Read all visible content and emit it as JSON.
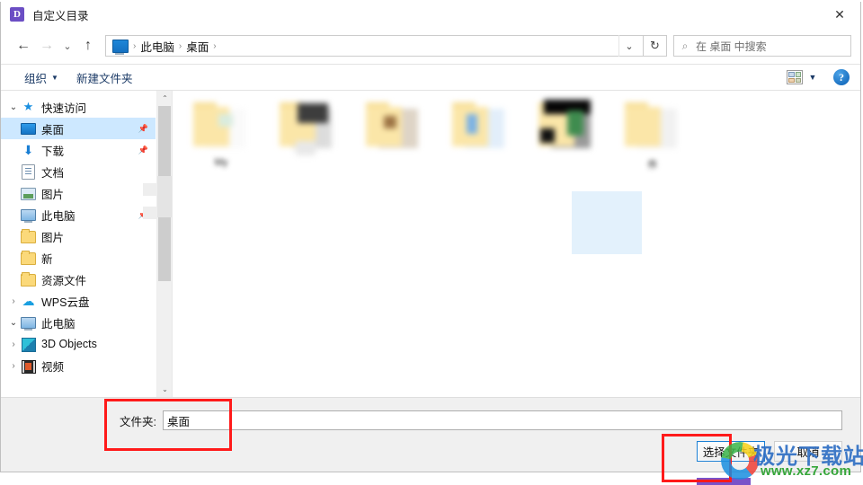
{
  "window": {
    "title": "自定义目录",
    "app_icon": "D",
    "app_icon_color": "#6b4ec4",
    "close_label": "✕"
  },
  "navbar": {
    "back_icon": "←",
    "forward_icon": "→",
    "recent_icon": "⌄",
    "up_icon": "↑",
    "breadcrumb": {
      "icon_name": "this-pc-icon",
      "items": [
        "此电脑",
        "桌面"
      ],
      "separator": "›",
      "dropdown_icon": "⌄"
    },
    "refresh_icon": "↻",
    "search": {
      "icon": "⌕",
      "placeholder": "在 桌面 中搜索",
      "value": ""
    }
  },
  "toolbar": {
    "organize_label": "组织",
    "organize_caret": "▼",
    "new_folder_label": "新建文件夹",
    "view_caret": "▼",
    "help_label": "?"
  },
  "sidebar": {
    "items": [
      {
        "label": "快速访问",
        "indent": 0,
        "twisty": "⌄",
        "icon": "quick-access-star-icon",
        "pinned": false,
        "selected": false
      },
      {
        "label": "桌面",
        "indent": 1,
        "twisty": "",
        "icon": "desktop-icon",
        "pinned": true,
        "selected": true
      },
      {
        "label": "下载",
        "indent": 1,
        "twisty": "",
        "icon": "downloads-icon",
        "pinned": true,
        "selected": false
      },
      {
        "label": "文档",
        "indent": 1,
        "twisty": "",
        "icon": "documents-icon",
        "pinned": false,
        "selected": false
      },
      {
        "label": "图片",
        "indent": 1,
        "twisty": "",
        "icon": "pictures-icon",
        "pinned": false,
        "selected": false
      },
      {
        "label": "此电脑",
        "indent": 1,
        "twisty": "",
        "icon": "this-pc-icon",
        "pinned": true,
        "selected": false
      },
      {
        "label": "图片",
        "indent": 1,
        "twisty": "",
        "icon": "folder-icon",
        "pinned": false,
        "selected": false
      },
      {
        "label": "新",
        "indent": 1,
        "twisty": "",
        "icon": "folder-icon",
        "pinned": false,
        "selected": false
      },
      {
        "label": "资源文件",
        "indent": 1,
        "twisty": "",
        "icon": "folder-icon",
        "pinned": false,
        "selected": false
      },
      {
        "label": "WPS云盘",
        "indent": 0,
        "twisty": "›",
        "icon": "cloud-icon",
        "pinned": false,
        "selected": false
      },
      {
        "label": "此电脑",
        "indent": 0,
        "twisty": "⌄",
        "icon": "this-pc-icon",
        "pinned": false,
        "selected": false
      },
      {
        "label": "3D Objects",
        "indent": 1,
        "twisty": "›",
        "icon": "3d-objects-icon",
        "pinned": false,
        "selected": false
      },
      {
        "label": "视频",
        "indent": 1,
        "twisty": "›",
        "icon": "videos-icon",
        "pinned": false,
        "selected": false
      }
    ],
    "scrollbar": {
      "up_arrow": "⌃",
      "down_arrow": "⌄"
    }
  },
  "files": {
    "items": [
      {
        "label": "My",
        "blurred": true,
        "selected": false
      },
      {
        "label": "",
        "blurred": true,
        "selected": false
      },
      {
        "label": "",
        "blurred": true,
        "selected": false
      },
      {
        "label": "",
        "blurred": true,
        "selected": true
      },
      {
        "label": "",
        "blurred": true,
        "selected": false
      },
      {
        "label": "件",
        "blurred": true,
        "selected": false
      }
    ]
  },
  "footer": {
    "folder_label": "文件夹:",
    "folder_value": "桌面",
    "select_button": "选择文件夹",
    "cancel_button": "取消"
  },
  "watermark": {
    "site_name": "极光下载站",
    "site_url": "www.xz7.com"
  },
  "colors": {
    "accent": "#1a7fd4",
    "selection": "#cde8ff",
    "annotation": "#ff1a1a",
    "watermark_blue": "#2f6fc4",
    "watermark_green": "#36a63a"
  }
}
